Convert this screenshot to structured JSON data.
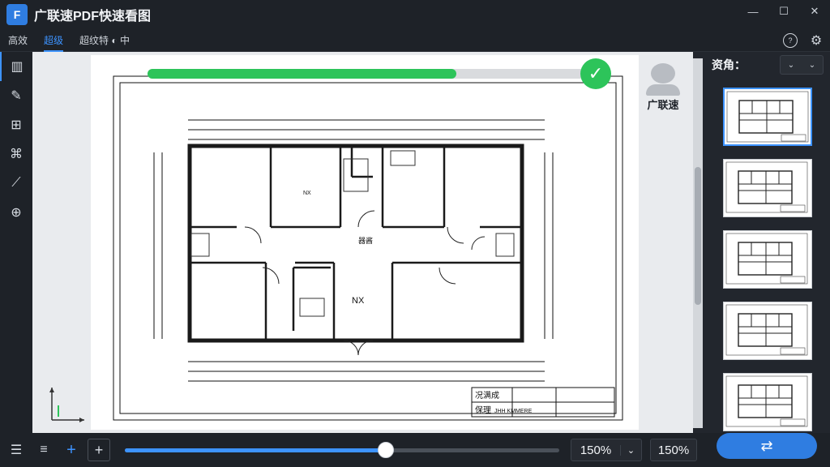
{
  "app": {
    "title": "广联速PDF快速看图",
    "logo_glyph": "F",
    "window": {
      "minimize": "—",
      "maximize": "☐",
      "close": "✕"
    }
  },
  "tabs": [
    {
      "label": "高效"
    },
    {
      "label": "超级",
      "active": true
    },
    {
      "label": "超纹特 ◐ 中"
    }
  ],
  "top_icons": {
    "help": "?",
    "settings": "⚙"
  },
  "left_tools": [
    {
      "name": "page-view-icon",
      "glyph": "▥"
    },
    {
      "name": "pencil-icon",
      "glyph": "✎"
    },
    {
      "name": "layers-icon",
      "glyph": "⊞"
    },
    {
      "name": "align-icon",
      "glyph": "⌘"
    },
    {
      "name": "measure-icon",
      "glyph": "⟋"
    },
    {
      "name": "target-icon",
      "glyph": "⊕"
    }
  ],
  "canvas": {
    "progress_percent": 68,
    "check_glyph": "✓",
    "avatar_label": "广联速",
    "room_label_center": "NX",
    "room_label_small": "NX",
    "room_label_hall": "器酱",
    "titleblock_line1": "况满成",
    "titleblock_line2": "保理 ",
    "titleblock_line2_extra": "JHH KMMERE"
  },
  "right_panel": {
    "header": "资角：",
    "dropdown_left": "⌄",
    "dropdown_right": "⌄",
    "thumbnail_count": 5,
    "active_thumbnail": 0
  },
  "bottom": {
    "slider_percent": 60,
    "zoom_value": "150%",
    "zoom_dropdown": "⌄",
    "zoom_value_2": "150%",
    "convert_glyph": "⇄",
    "buttons": {
      "list": "☰",
      "menu": "≡",
      "zoom_in_blue": "+",
      "zoom_in_box": "+"
    }
  },
  "colors": {
    "accent": "#3d93ff",
    "success": "#2dc45a",
    "background": "#22262d"
  }
}
